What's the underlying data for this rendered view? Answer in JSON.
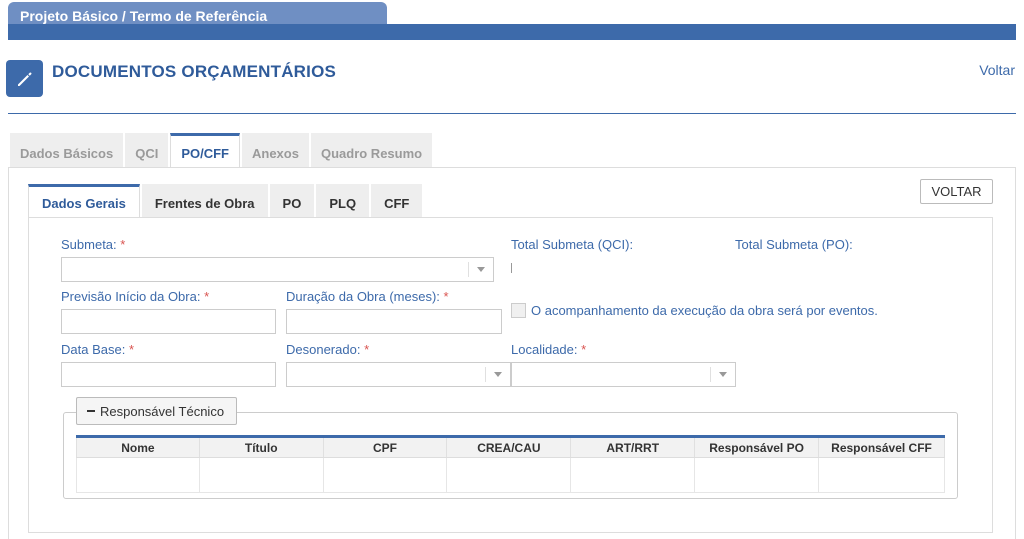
{
  "header": {
    "tab_title": "Projeto Básico / Termo de Referência",
    "section_title": "DOCUMENTOS ORÇAMENTÁRIOS",
    "back_link": "Voltar",
    "section_icon": "pencil-icon"
  },
  "main_tabs": [
    {
      "label": "Dados Básicos"
    },
    {
      "label": "QCI"
    },
    {
      "label": "PO/CFF"
    },
    {
      "label": "Anexos"
    },
    {
      "label": "Quadro Resumo"
    }
  ],
  "sub_tabs": [
    {
      "label": "Dados Gerais"
    },
    {
      "label": "Frentes de Obra"
    },
    {
      "label": "PO"
    },
    {
      "label": "PLQ"
    },
    {
      "label": "CFF"
    }
  ],
  "voltar_button": "VOLTAR",
  "form": {
    "submeta_label": "Submeta:",
    "total_submeta_qci_label": "Total Submeta (QCI):",
    "total_submeta_po_label": "Total Submeta (PO):",
    "previsao_label": "Previsão Início da Obra:",
    "duracao_label": "Duração da Obra (meses):",
    "eventos_label": "O acompanhamento da execução da obra será por eventos.",
    "data_base_label": "Data Base:",
    "desonerado_label": "Desonerado:",
    "localidade_label": "Localidade:",
    "required_mark": "*"
  },
  "responsavel": {
    "toggle_label": "Responsável Técnico",
    "columns": [
      "Nome",
      "Título",
      "CPF",
      "CREA/CAU",
      "ART/RRT",
      "Responsável PO",
      "Responsável CFF"
    ]
  }
}
